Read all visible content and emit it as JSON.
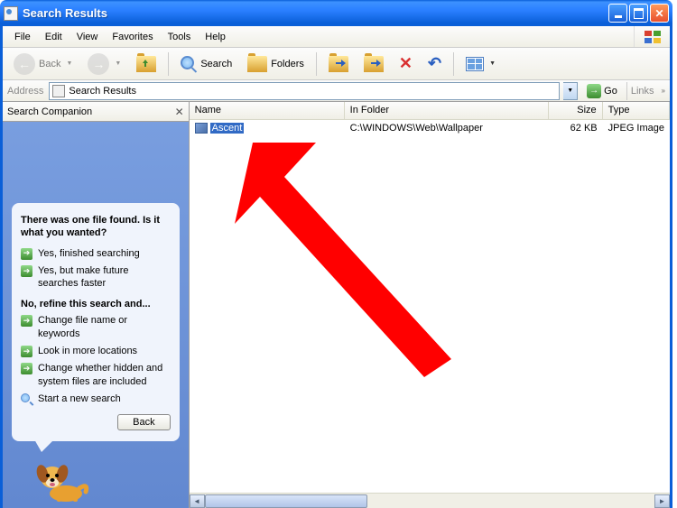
{
  "titlebar": {
    "title": "Search Results"
  },
  "menubar": {
    "items": [
      "File",
      "Edit",
      "View",
      "Favorites",
      "Tools",
      "Help"
    ]
  },
  "toolbar": {
    "back_label": "Back",
    "search_label": "Search",
    "folders_label": "Folders"
  },
  "addressbar": {
    "label": "Address",
    "value": "Search Results",
    "go_label": "Go",
    "links_label": "Links"
  },
  "sidebar": {
    "title": "Search Companion",
    "question": "There was one file found.  Is it what you wanted?",
    "options_yes": [
      "Yes, finished searching",
      "Yes, but make future searches faster"
    ],
    "question2": "No, refine this search and...",
    "options_refine": [
      "Change file name or keywords",
      "Look in more locations",
      "Change whether hidden and system files are included"
    ],
    "new_search": "Start a new search",
    "back_label": "Back"
  },
  "results": {
    "columns": {
      "name": "Name",
      "folder": "In Folder",
      "size": "Size",
      "type": "Type"
    },
    "rows": [
      {
        "name": "Ascent",
        "folder": "C:\\WINDOWS\\Web\\Wallpaper",
        "size": "62 KB",
        "type": "JPEG Image",
        "selected": true
      }
    ]
  },
  "annotation": {
    "arrow_color": "#ff0000"
  }
}
